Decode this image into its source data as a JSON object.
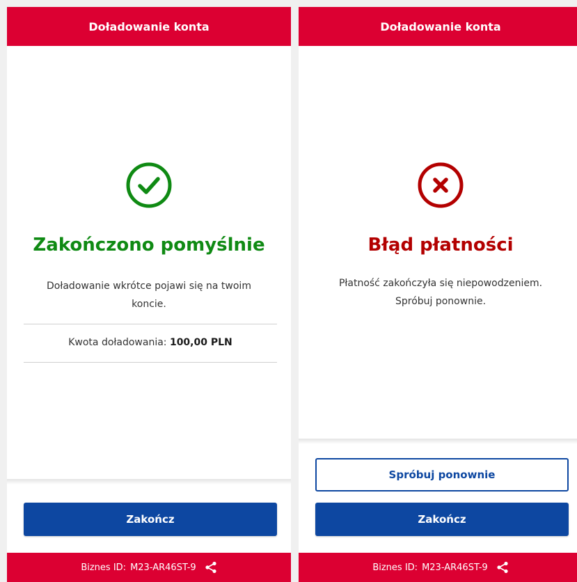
{
  "colors": {
    "brand_red": "#dc0032",
    "primary_blue": "#0d47a1",
    "success_green": "#0f8a13",
    "error_red": "#b30000"
  },
  "success_screen": {
    "header_title": "Doładowanie konta",
    "status_icon": "check-circle-icon",
    "status_title": "Zakończono pomyślnie",
    "message": "Doładowanie wkrótce pojawi się na twoim koncie.",
    "amount_label": "Kwota doładowania: ",
    "amount_value": "100,00 PLN",
    "finish_button": "Zakończ",
    "footer_label": "Biznes ID:",
    "footer_id": "M23-AR46ST-9",
    "footer_icon": "share-icon"
  },
  "error_screen": {
    "header_title": "Doładowanie konta",
    "status_icon": "x-circle-icon",
    "status_title": "Błąd płatności",
    "message": "Płatność zakończyła się niepowodzeniem. Spróbuj ponownie.",
    "retry_button": "Spróbuj ponownie",
    "finish_button": "Zakończ",
    "footer_label": "Biznes ID:",
    "footer_id": "M23-AR46ST-9",
    "footer_icon": "share-icon"
  }
}
